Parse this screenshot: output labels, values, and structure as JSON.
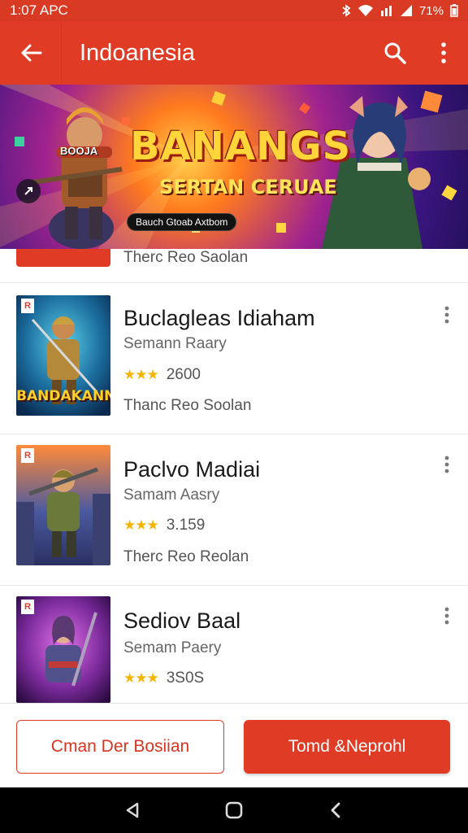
{
  "status_bar": {
    "time": "1:07 APC",
    "battery_text": "71%"
  },
  "app_bar": {
    "title": "Indoanesia",
    "back_icon": "arrow-left-icon",
    "search_icon": "search-icon",
    "more_icon": "more-vertical-icon"
  },
  "banner": {
    "title": "BANANGS",
    "subtitle": "SERTAN CERUAE",
    "tag": "Bauch Gtoab Axtbom",
    "play_icon": "play-icon",
    "character_text": "BOOJA"
  },
  "partial_item": {
    "meta": "Therc Reo Saolan"
  },
  "games": [
    {
      "title": "Buclagleas Idiaham",
      "developer": "Semann Raary",
      "stars": "★★★",
      "rating": "2600",
      "meta": "Thanc Reo Soolan",
      "thumb_caption": "BANDAKANN",
      "badge": "R"
    },
    {
      "title": "Paclvo Madiai",
      "developer": "Samam Aasry",
      "stars": "★★★",
      "rating": "3.159",
      "meta": "Therc Reo Reolan",
      "thumb_caption": "",
      "badge": "R"
    },
    {
      "title": "Sediov Baal",
      "developer": "Semam Paery",
      "stars": "★★★",
      "rating": "3S0S",
      "meta": "",
      "thumb_caption": "",
      "badge": "R"
    }
  ],
  "actions": {
    "secondary_label": "Cman Der Bosiian",
    "primary_label": "Tomd &Neprohl"
  },
  "nav": {
    "back_icon": "nav-back-icon",
    "home_icon": "nav-home-icon",
    "recents_icon": "nav-recents-icon"
  },
  "colors": {
    "primary": "#e03c25",
    "status_bar": "#d93a23",
    "star": "#f4b400"
  }
}
